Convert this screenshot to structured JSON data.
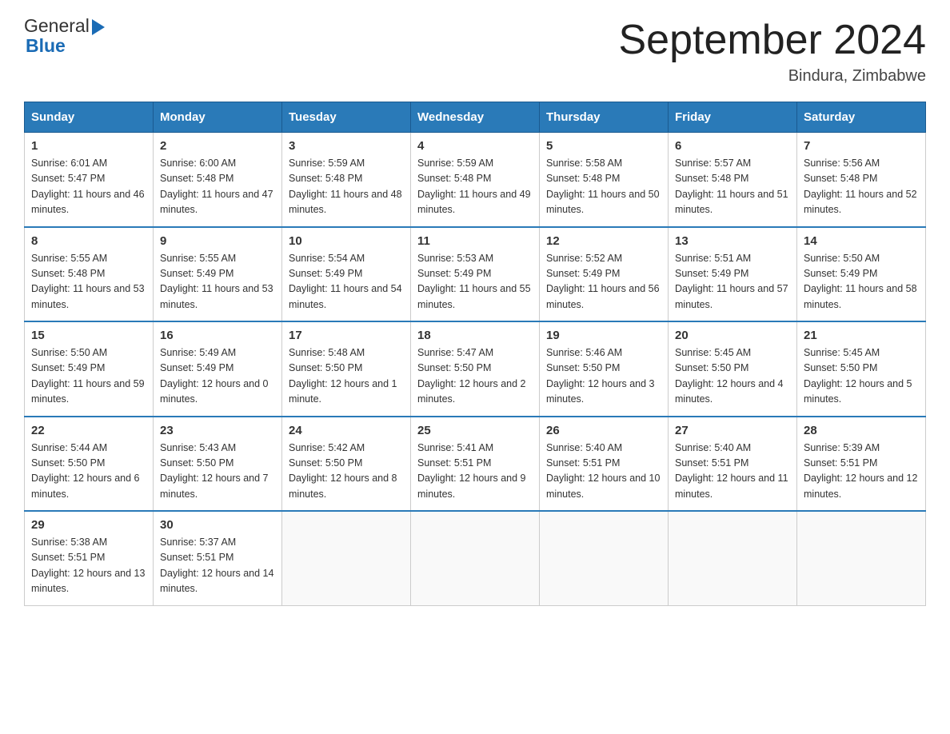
{
  "header": {
    "month_year": "September 2024",
    "location": "Bindura, Zimbabwe",
    "logo_general": "General",
    "logo_blue": "Blue"
  },
  "columns": [
    "Sunday",
    "Monday",
    "Tuesday",
    "Wednesday",
    "Thursday",
    "Friday",
    "Saturday"
  ],
  "weeks": [
    [
      {
        "day": "1",
        "sunrise": "6:01 AM",
        "sunset": "5:47 PM",
        "daylight": "11 hours and 46 minutes."
      },
      {
        "day": "2",
        "sunrise": "6:00 AM",
        "sunset": "5:48 PM",
        "daylight": "11 hours and 47 minutes."
      },
      {
        "day": "3",
        "sunrise": "5:59 AM",
        "sunset": "5:48 PM",
        "daylight": "11 hours and 48 minutes."
      },
      {
        "day": "4",
        "sunrise": "5:59 AM",
        "sunset": "5:48 PM",
        "daylight": "11 hours and 49 minutes."
      },
      {
        "day": "5",
        "sunrise": "5:58 AM",
        "sunset": "5:48 PM",
        "daylight": "11 hours and 50 minutes."
      },
      {
        "day": "6",
        "sunrise": "5:57 AM",
        "sunset": "5:48 PM",
        "daylight": "11 hours and 51 minutes."
      },
      {
        "day": "7",
        "sunrise": "5:56 AM",
        "sunset": "5:48 PM",
        "daylight": "11 hours and 52 minutes."
      }
    ],
    [
      {
        "day": "8",
        "sunrise": "5:55 AM",
        "sunset": "5:48 PM",
        "daylight": "11 hours and 53 minutes."
      },
      {
        "day": "9",
        "sunrise": "5:55 AM",
        "sunset": "5:49 PM",
        "daylight": "11 hours and 53 minutes."
      },
      {
        "day": "10",
        "sunrise": "5:54 AM",
        "sunset": "5:49 PM",
        "daylight": "11 hours and 54 minutes."
      },
      {
        "day": "11",
        "sunrise": "5:53 AM",
        "sunset": "5:49 PM",
        "daylight": "11 hours and 55 minutes."
      },
      {
        "day": "12",
        "sunrise": "5:52 AM",
        "sunset": "5:49 PM",
        "daylight": "11 hours and 56 minutes."
      },
      {
        "day": "13",
        "sunrise": "5:51 AM",
        "sunset": "5:49 PM",
        "daylight": "11 hours and 57 minutes."
      },
      {
        "day": "14",
        "sunrise": "5:50 AM",
        "sunset": "5:49 PM",
        "daylight": "11 hours and 58 minutes."
      }
    ],
    [
      {
        "day": "15",
        "sunrise": "5:50 AM",
        "sunset": "5:49 PM",
        "daylight": "11 hours and 59 minutes."
      },
      {
        "day": "16",
        "sunrise": "5:49 AM",
        "sunset": "5:49 PM",
        "daylight": "12 hours and 0 minutes."
      },
      {
        "day": "17",
        "sunrise": "5:48 AM",
        "sunset": "5:50 PM",
        "daylight": "12 hours and 1 minute."
      },
      {
        "day": "18",
        "sunrise": "5:47 AM",
        "sunset": "5:50 PM",
        "daylight": "12 hours and 2 minutes."
      },
      {
        "day": "19",
        "sunrise": "5:46 AM",
        "sunset": "5:50 PM",
        "daylight": "12 hours and 3 minutes."
      },
      {
        "day": "20",
        "sunrise": "5:45 AM",
        "sunset": "5:50 PM",
        "daylight": "12 hours and 4 minutes."
      },
      {
        "day": "21",
        "sunrise": "5:45 AM",
        "sunset": "5:50 PM",
        "daylight": "12 hours and 5 minutes."
      }
    ],
    [
      {
        "day": "22",
        "sunrise": "5:44 AM",
        "sunset": "5:50 PM",
        "daylight": "12 hours and 6 minutes."
      },
      {
        "day": "23",
        "sunrise": "5:43 AM",
        "sunset": "5:50 PM",
        "daylight": "12 hours and 7 minutes."
      },
      {
        "day": "24",
        "sunrise": "5:42 AM",
        "sunset": "5:50 PM",
        "daylight": "12 hours and 8 minutes."
      },
      {
        "day": "25",
        "sunrise": "5:41 AM",
        "sunset": "5:51 PM",
        "daylight": "12 hours and 9 minutes."
      },
      {
        "day": "26",
        "sunrise": "5:40 AM",
        "sunset": "5:51 PM",
        "daylight": "12 hours and 10 minutes."
      },
      {
        "day": "27",
        "sunrise": "5:40 AM",
        "sunset": "5:51 PM",
        "daylight": "12 hours and 11 minutes."
      },
      {
        "day": "28",
        "sunrise": "5:39 AM",
        "sunset": "5:51 PM",
        "daylight": "12 hours and 12 minutes."
      }
    ],
    [
      {
        "day": "29",
        "sunrise": "5:38 AM",
        "sunset": "5:51 PM",
        "daylight": "12 hours and 13 minutes."
      },
      {
        "day": "30",
        "sunrise": "5:37 AM",
        "sunset": "5:51 PM",
        "daylight": "12 hours and 14 minutes."
      },
      null,
      null,
      null,
      null,
      null
    ]
  ],
  "labels": {
    "sunrise": "Sunrise:",
    "sunset": "Sunset:",
    "daylight": "Daylight:"
  },
  "colors": {
    "header_bg": "#2a7ab8",
    "border_accent": "#2a7ab8"
  }
}
